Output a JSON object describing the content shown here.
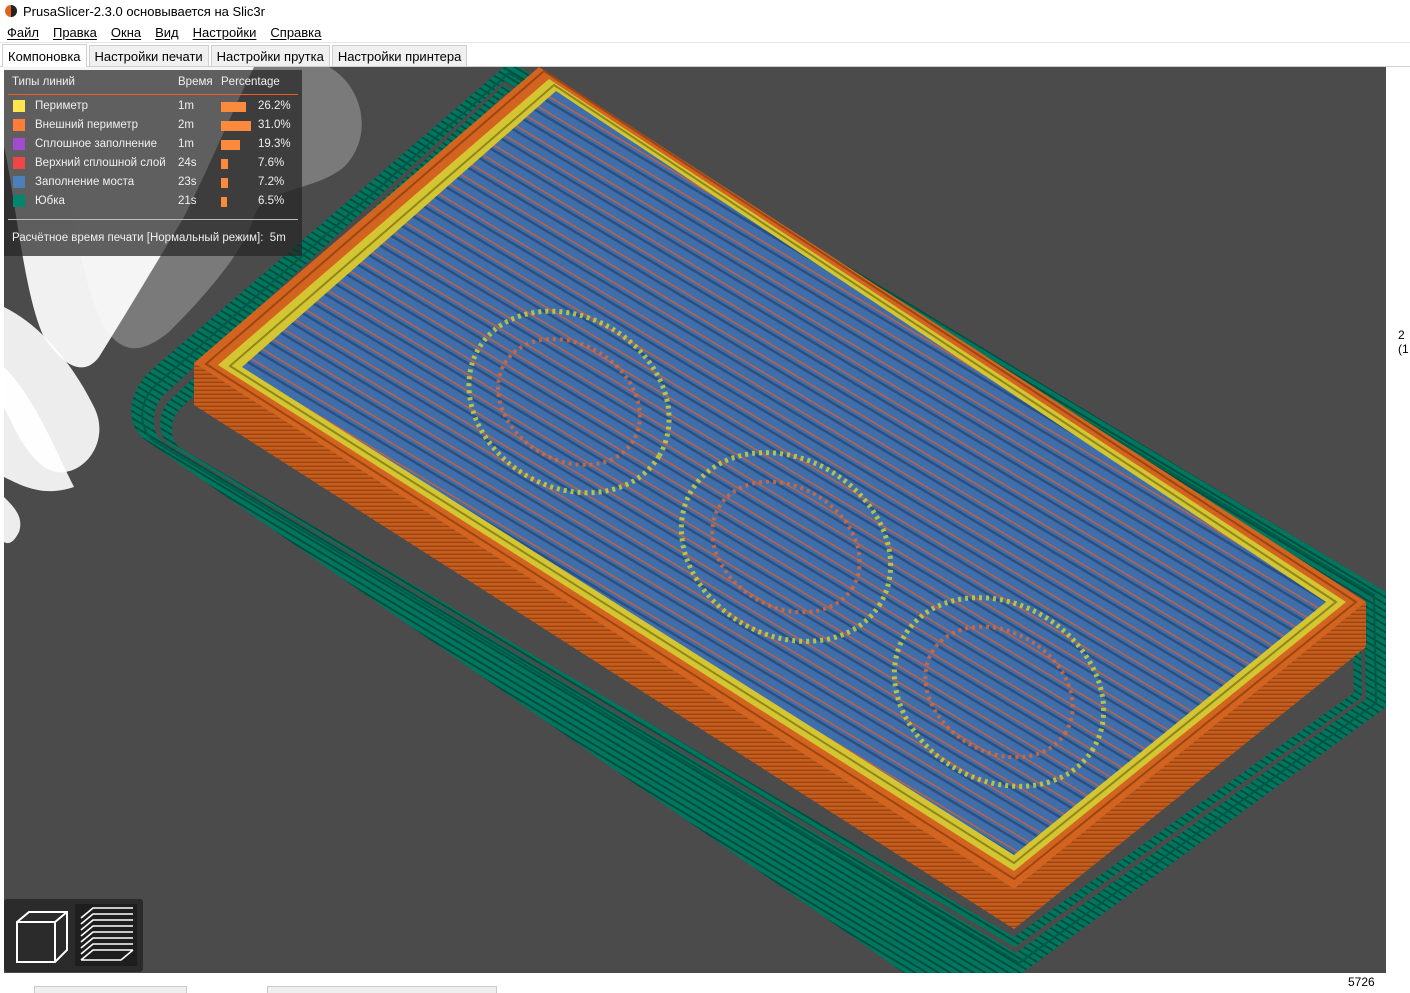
{
  "window": {
    "title": "PrusaSlicer-2.3.0 основывается на Slic3r"
  },
  "menu": {
    "items": [
      "Файл",
      "Правка",
      "Окна",
      "Вид",
      "Настройки",
      "Справка"
    ]
  },
  "tabs": {
    "items": [
      "Компоновка",
      "Настройки печати",
      "Настройки прутка",
      "Настройки принтера"
    ],
    "active": "Компоновка"
  },
  "legend": {
    "headers": {
      "type": "Типы линий",
      "time": "Время",
      "percentage": "Percentage"
    },
    "rows": [
      {
        "label": "Периметр",
        "time": "1m",
        "percent": "26.2%",
        "value": 26.2,
        "color": "#ffe64d"
      },
      {
        "label": "Внешний периметр",
        "time": "2m",
        "percent": "31.0%",
        "value": 31.0,
        "color": "#ff7d38"
      },
      {
        "label": "Сплошное заполнение",
        "time": "1m",
        "percent": "19.3%",
        "value": 19.3,
        "color": "#a34bcf"
      },
      {
        "label": "Верхний сплошной слой",
        "time": "24s",
        "percent": "7.6%",
        "value": 7.6,
        "color": "#f04646"
      },
      {
        "label": "Заполнение моста",
        "time": "23s",
        "percent": "7.2%",
        "value": 7.2,
        "color": "#4d80ba"
      },
      {
        "label": "Юбка",
        "time": "21s",
        "percent": "6.5%",
        "value": 6.5,
        "color": "#00876e"
      }
    ],
    "estimate_label": "Расчётное время печати [Нормальный режим]:",
    "estimate_value": "5m"
  },
  "view_toggles": {
    "items": [
      {
        "icon": "3d-view-cube-icon",
        "selected": false
      },
      {
        "icon": "layers-preview-icon",
        "selected": true
      }
    ]
  },
  "right_edge": {
    "line1": "2",
    "line2": "(1"
  },
  "slider": {
    "layer_value": "5726"
  }
}
